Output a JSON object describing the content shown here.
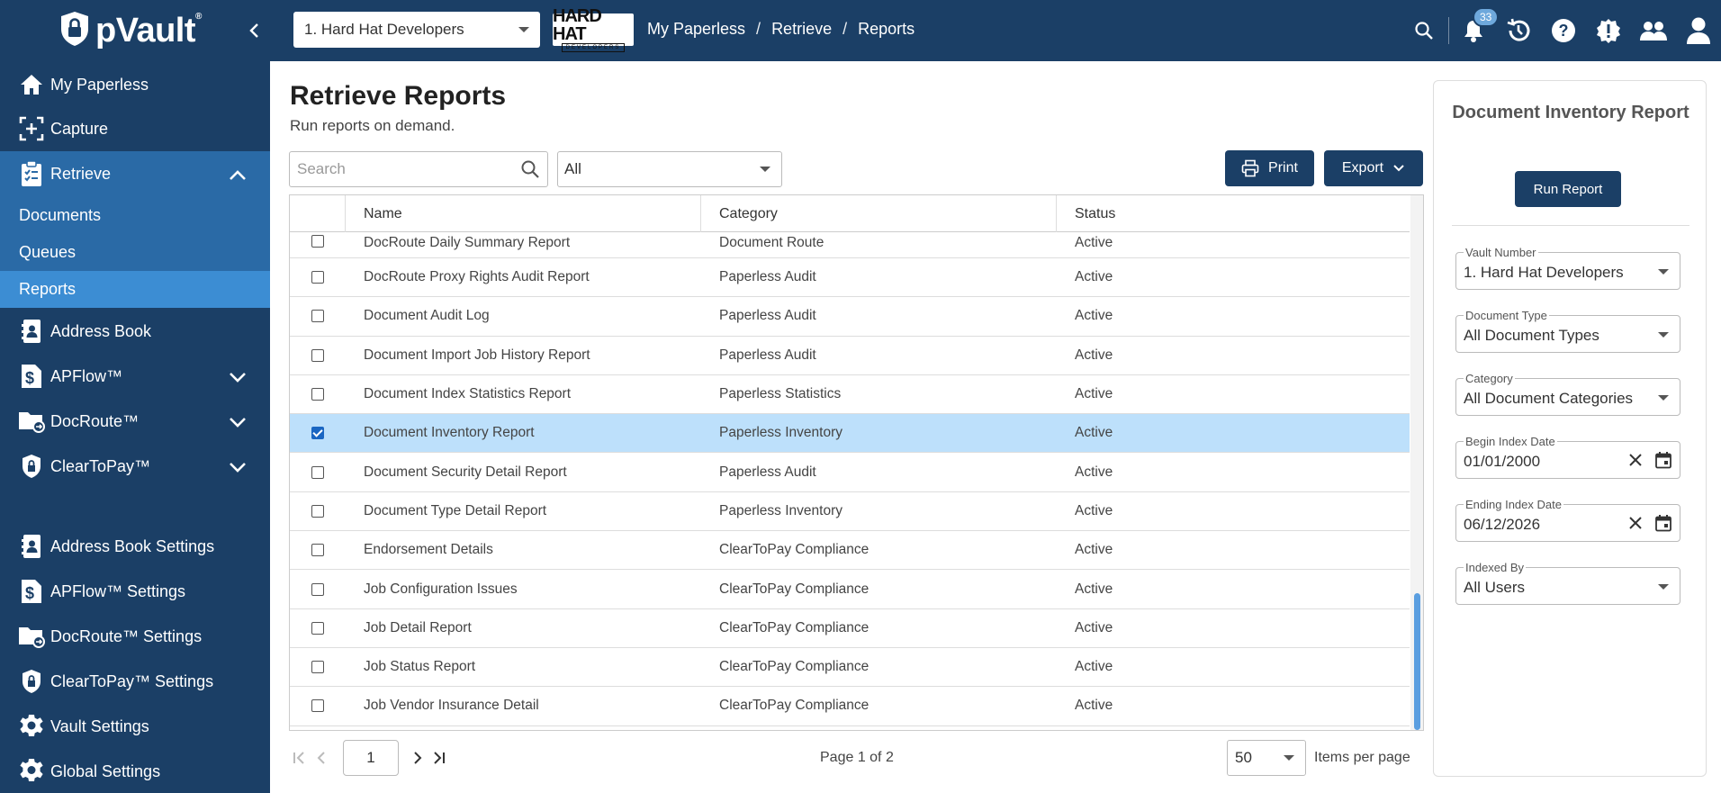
{
  "app": {
    "logo_text": "pVault",
    "logo_mark": "®",
    "vault_select": "1. Hard Hat Developers",
    "client_logo_main": "HARD HAT",
    "client_logo_sub": "DEVELOPERS",
    "breadcrumb": [
      "My Paperless",
      "Retrieve",
      "Reports"
    ],
    "notification_count": "33"
  },
  "sidebar": {
    "items": [
      {
        "label": "My Paperless",
        "icon": "home-icon"
      },
      {
        "label": "Capture",
        "icon": "capture-icon"
      },
      {
        "label": "Retrieve",
        "icon": "clipboard-icon"
      },
      {
        "label": "Address Book",
        "icon": "address-book-icon"
      },
      {
        "label": "APFlow™",
        "icon": "dollar-doc-icon"
      },
      {
        "label": "DocRoute™",
        "icon": "folder-route-icon"
      },
      {
        "label": "ClearToPay™",
        "icon": "shield-lock-icon"
      },
      {
        "label": "Address Book Settings",
        "icon": "address-book-icon"
      },
      {
        "label": "APFlow™ Settings",
        "icon": "dollar-doc-icon"
      },
      {
        "label": "DocRoute™ Settings",
        "icon": "folder-route-icon"
      },
      {
        "label": "ClearToPay™ Settings",
        "icon": "shield-lock-icon"
      },
      {
        "label": "Vault Settings",
        "icon": "gear-icon"
      },
      {
        "label": "Global Settings",
        "icon": "gears-icon"
      }
    ],
    "retrieve_sub": [
      "Documents",
      "Queues",
      "Reports"
    ]
  },
  "main": {
    "title": "Retrieve Reports",
    "subtitle": "Run reports on demand.",
    "search_placeholder": "Search",
    "filter_value": "All",
    "print_label": "Print",
    "export_label": "Export",
    "columns": [
      "Name",
      "Category",
      "Status"
    ],
    "rows": [
      {
        "name": "DocRoute Daily Summary Report",
        "category": "Document Route",
        "status": "Active",
        "checked": false
      },
      {
        "name": "DocRoute Proxy Rights Audit Report",
        "category": "Paperless Audit",
        "status": "Active",
        "checked": false
      },
      {
        "name": "Document Audit Log",
        "category": "Paperless Audit",
        "status": "Active",
        "checked": false
      },
      {
        "name": "Document Import Job History Report",
        "category": "Paperless Audit",
        "status": "Active",
        "checked": false
      },
      {
        "name": "Document Index Statistics Report",
        "category": "Paperless Statistics",
        "status": "Active",
        "checked": false
      },
      {
        "name": "Document Inventory Report",
        "category": "Paperless Inventory",
        "status": "Active",
        "checked": true
      },
      {
        "name": "Document Security Detail Report",
        "category": "Paperless Audit",
        "status": "Active",
        "checked": false
      },
      {
        "name": "Document Type Detail Report",
        "category": "Paperless Inventory",
        "status": "Active",
        "checked": false
      },
      {
        "name": "Endorsement Details",
        "category": "ClearToPay Compliance",
        "status": "Active",
        "checked": false
      },
      {
        "name": "Job Configuration Issues",
        "category": "ClearToPay Compliance",
        "status": "Active",
        "checked": false
      },
      {
        "name": "Job Detail Report",
        "category": "ClearToPay Compliance",
        "status": "Active",
        "checked": false
      },
      {
        "name": "Job Status Report",
        "category": "ClearToPay Compliance",
        "status": "Active",
        "checked": false
      },
      {
        "name": "Job Vendor Insurance Detail",
        "category": "ClearToPay Compliance",
        "status": "Active",
        "checked": false
      }
    ],
    "pager": {
      "page_input": "1",
      "page_label": "Page 1 of 2",
      "items_per_page": "50",
      "items_per_page_label": "Items per page"
    }
  },
  "panel": {
    "title": "Document Inventory Report",
    "run_label": "Run Report",
    "fields": [
      {
        "label": "Vault Number",
        "value": "1. Hard Hat Developers",
        "kind": "select"
      },
      {
        "label": "Document Type",
        "value": "All Document Types",
        "kind": "select"
      },
      {
        "label": "Category",
        "value": "All Document Categories",
        "kind": "select"
      },
      {
        "label": "Begin Index Date",
        "value": "01/01/2000",
        "kind": "date"
      },
      {
        "label": "Ending Index Date",
        "value": "06/12/2026",
        "kind": "date"
      },
      {
        "label": "Indexed By",
        "value": "All Users",
        "kind": "select"
      }
    ]
  },
  "colors": {
    "nav_bg": "#1b3f66",
    "nav_active_group": "#2a6aa6",
    "nav_active_item": "#3c8dd3",
    "selected_row": "#bde0fb",
    "accent": "#1a66c2"
  }
}
